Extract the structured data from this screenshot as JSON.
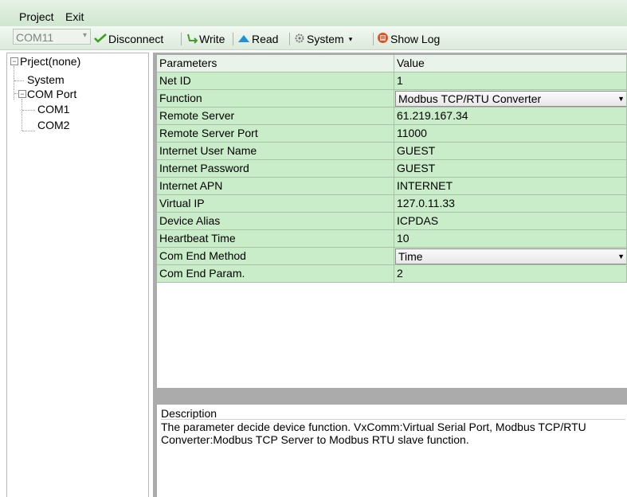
{
  "menu": {
    "project": "Project",
    "exit": "Exit"
  },
  "toolbar": {
    "com_port": "COM11",
    "disconnect": "Disconnect",
    "write": "Write",
    "read": "Read",
    "system": "System",
    "show_log": "Show Log"
  },
  "tree": {
    "root": "Prject(none)",
    "system": "System",
    "com_port": "COM Port",
    "com1": "COM1",
    "com2": "COM2"
  },
  "grid": {
    "header": {
      "name": "Parameters",
      "value": "Value"
    },
    "rows": [
      {
        "name": "Net ID",
        "value": "1"
      },
      {
        "name": "Function",
        "value": "Modbus TCP/RTU Converter"
      },
      {
        "name": "Remote Server",
        "value": "61.219.167.34"
      },
      {
        "name": "Remote Server Port",
        "value": "11000"
      },
      {
        "name": "Internet User Name",
        "value": "GUEST"
      },
      {
        "name": "Internet Password",
        "value": "GUEST"
      },
      {
        "name": "Internet APN",
        "value": "INTERNET"
      },
      {
        "name": "Virtual IP",
        "value": "127.0.11.33"
      },
      {
        "name": "Device Alias",
        "value": "ICPDAS"
      },
      {
        "name": "Heartbeat Time",
        "value": "10"
      },
      {
        "name": "Com End Method",
        "value": "Time"
      },
      {
        "name": "Com End Param.",
        "value": "2"
      }
    ]
  },
  "description": {
    "title": "Description",
    "text": "The parameter decide device function. VxComm:Virtual Serial Port, Modbus TCP/RTU Converter:Modbus TCP Server to Modbus RTU slave function."
  },
  "colors": {
    "row_bg": "#c9ecc9",
    "header_bg": "#eaf3ea",
    "pane_gray": "#ababab"
  },
  "icons": {
    "disconnect": "check-icon",
    "write": "write-arrow-icon",
    "read": "read-triangle-icon",
    "system": "gear-icon",
    "show_log": "log-icon"
  }
}
